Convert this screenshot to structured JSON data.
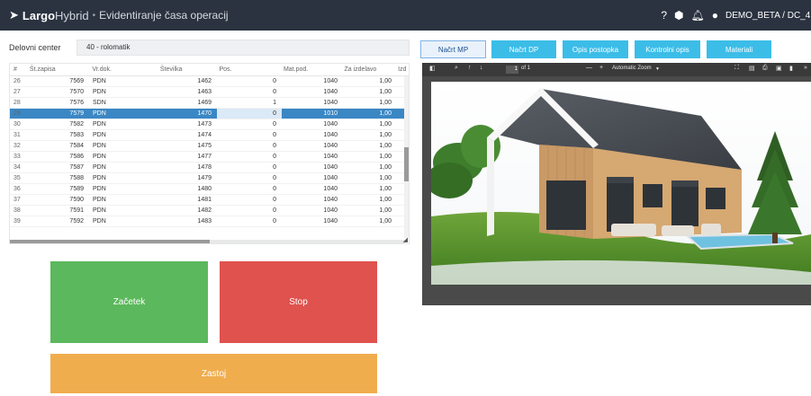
{
  "header": {
    "brand_bold": "Largo",
    "brand_light": "Hybrid",
    "separator": "•",
    "subtitle": "Evidentiranje časa operacij",
    "user": "DEMO_BETA / DC_4"
  },
  "filter": {
    "label": "Delovni center",
    "value": "40 - rolomatik"
  },
  "grid": {
    "columns": [
      "#",
      "Št.zapisa",
      "Vr.dok.",
      "Številka",
      "Pos.",
      "Mat.pod.",
      "Za izdelavo",
      "Izd"
    ],
    "rows": [
      {
        "num": "26",
        "st": "7569",
        "vr": "PDN",
        "stevilka": "1462",
        "pos": "0",
        "mat": "1040",
        "za": "1,00"
      },
      {
        "num": "27",
        "st": "7570",
        "vr": "PDN",
        "stevilka": "1463",
        "pos": "0",
        "mat": "1040",
        "za": "1,00"
      },
      {
        "num": "28",
        "st": "7576",
        "vr": "SDN",
        "stevilka": "1469",
        "pos": "1",
        "mat": "1040",
        "za": "1,00"
      },
      {
        "num": "29",
        "st": "7579",
        "vr": "PDN",
        "stevilka": "1470",
        "pos": "0",
        "mat": "1010",
        "za": "1,00"
      },
      {
        "num": "30",
        "st": "7582",
        "vr": "PDN",
        "stevilka": "1473",
        "pos": "0",
        "mat": "1040",
        "za": "1,00"
      },
      {
        "num": "31",
        "st": "7583",
        "vr": "PDN",
        "stevilka": "1474",
        "pos": "0",
        "mat": "1040",
        "za": "1,00"
      },
      {
        "num": "32",
        "st": "7584",
        "vr": "PDN",
        "stevilka": "1475",
        "pos": "0",
        "mat": "1040",
        "za": "1,00"
      },
      {
        "num": "33",
        "st": "7586",
        "vr": "PDN",
        "stevilka": "1477",
        "pos": "0",
        "mat": "1040",
        "za": "1,00"
      },
      {
        "num": "34",
        "st": "7587",
        "vr": "PDN",
        "stevilka": "1478",
        "pos": "0",
        "mat": "1040",
        "za": "1,00"
      },
      {
        "num": "35",
        "st": "7588",
        "vr": "PDN",
        "stevilka": "1479",
        "pos": "0",
        "mat": "1040",
        "za": "1,00"
      },
      {
        "num": "36",
        "st": "7589",
        "vr": "PDN",
        "stevilka": "1480",
        "pos": "0",
        "mat": "1040",
        "za": "1,00"
      },
      {
        "num": "37",
        "st": "7590",
        "vr": "PDN",
        "stevilka": "1481",
        "pos": "0",
        "mat": "1040",
        "za": "1,00"
      },
      {
        "num": "38",
        "st": "7591",
        "vr": "PDN",
        "stevilka": "1482",
        "pos": "0",
        "mat": "1040",
        "za": "1,00"
      },
      {
        "num": "39",
        "st": "7592",
        "vr": "PDN",
        "stevilka": "1483",
        "pos": "0",
        "mat": "1040",
        "za": "1,00"
      }
    ],
    "selected_row": 3
  },
  "actions": {
    "start": "Začetek",
    "stop": "Stop",
    "idle": "Zastoj"
  },
  "tabs": [
    "Načrt MP",
    "Načrt DP",
    "Opis postopka",
    "Kontrolni opis",
    "Materiali"
  ],
  "viewer": {
    "page_num": "1",
    "page_of": "of 1",
    "zoom_minus": "—",
    "zoom_plus": "+",
    "zoom": "Automatic Zoom"
  },
  "colors": {
    "header_bg": "#2b3340",
    "selected_row": "#3a87c4",
    "start": "#5cb85c",
    "stop": "#e0524e",
    "idle": "#f0ad4e",
    "tab": "#3bbde8"
  },
  "icons": {
    "brand": "check-arrow-icon",
    "help": "question-icon",
    "package": "box-icon",
    "notify": "bell-icon",
    "user": "user-icon"
  }
}
